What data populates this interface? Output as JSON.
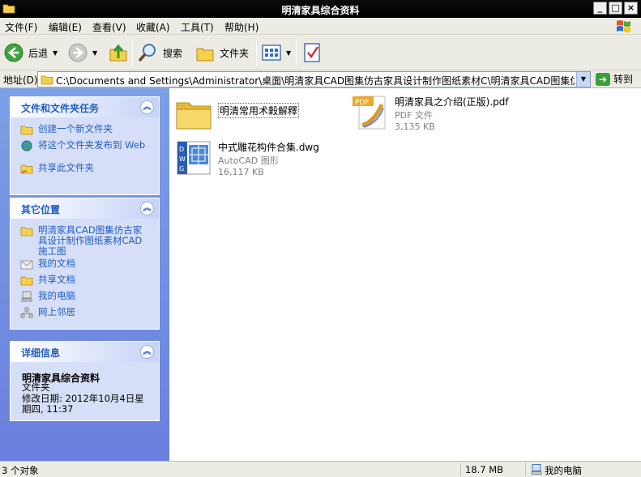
{
  "window": {
    "title": "明清家具综合资料",
    "minimize": "_",
    "maximize": "□",
    "close": "×"
  },
  "menu": [
    "文件(F)",
    "编辑(E)",
    "查看(V)",
    "收藏(A)",
    "工具(T)",
    "帮助(H)"
  ],
  "toolbar": {
    "back": "后退",
    "search": "搜索",
    "folders": "文件夹"
  },
  "address": {
    "label": "地址(D)",
    "path": "C:\\Documents and Settings\\Administrator\\桌面\\明清家具CAD图集仿古家具设计制作图纸素材C\\明清家具CAD图集仿古家具设计",
    "go": "转到"
  },
  "panels": {
    "tasks": {
      "title": "文件和文件夹任务",
      "items": [
        "创建一个新文件夹",
        "将这个文件夹发布到 Web",
        "共享此文件夹"
      ]
    },
    "places": {
      "title": "其它位置",
      "items": [
        "明清家具CAD图集仿古家具设计制作图纸素材CAD施工图",
        "我的文档",
        "共享文档",
        "我的电脑",
        "网上邻居"
      ]
    },
    "details": {
      "title": "详细信息",
      "name": "明清家具综合资料",
      "type": "文件夹",
      "modified": "修改日期: 2012年10月4日星期四, 11:37"
    }
  },
  "files": [
    {
      "name": "明清常用术榖解釋",
      "type": "",
      "size": "",
      "icon": "folder-icon"
    },
    {
      "name": "明清家具之介绍(正版).pdf",
      "type": "PDF 文件",
      "size": "3,135 KB",
      "icon": "pdf-icon"
    },
    {
      "name": "中式雕花构件合集.dwg",
      "type": "AutoCAD 图形",
      "size": "16,117 KB",
      "icon": "dwg-icon"
    }
  ],
  "status": {
    "count": "3 个对象",
    "size": "18.7 MB",
    "location": "我的电脑"
  }
}
